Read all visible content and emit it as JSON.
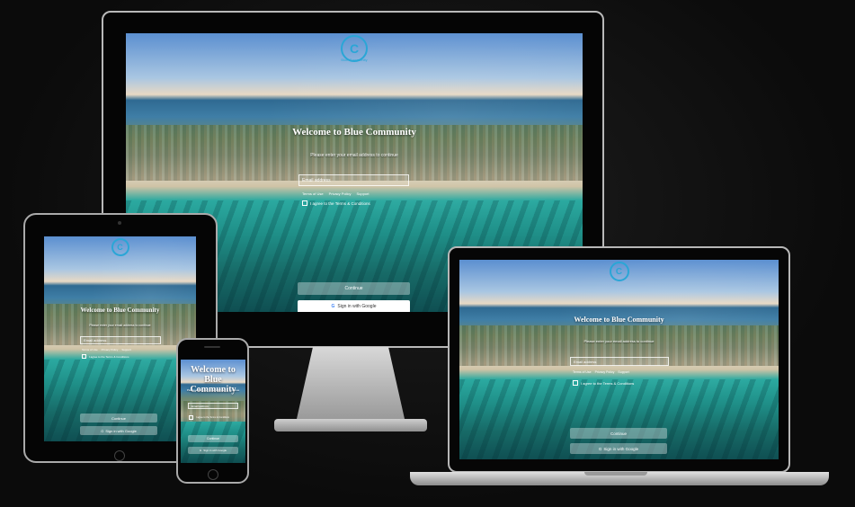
{
  "brand": {
    "logo_text": "Blue Community",
    "accent": "#2aa6d6"
  },
  "welcome": {
    "title": "Welcome to Blue Community",
    "subtitle": "Please enter your email address to continue"
  },
  "form": {
    "email_placeholder": "Email address",
    "links": [
      "Terms of Use",
      "Privacy Policy",
      "Support"
    ],
    "agree_label": "I agree to the Terms & Conditions",
    "continue_label": "Continue",
    "google_label": "Sign in with Google"
  }
}
